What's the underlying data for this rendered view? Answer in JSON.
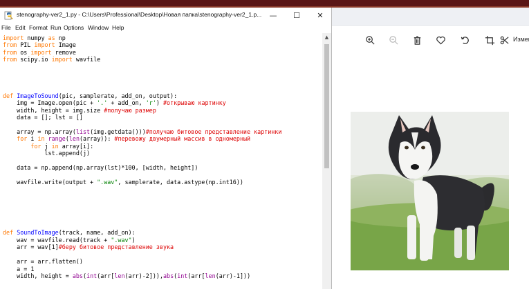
{
  "editor_window": {
    "title": "stenography-ver2_1.py - C:\\Users\\Professional\\Desktop\\Новая папка\\stenography-ver2_1.p...",
    "controls": {
      "minimize": "—",
      "maximize": "☐",
      "close": "✕"
    },
    "menu": [
      "File",
      "Edit",
      "Format",
      "Run",
      "Options",
      "Window",
      "Help"
    ],
    "code_lines": [
      [
        {
          "t": "import",
          "c": "kw"
        },
        {
          "t": " numpy "
        },
        {
          "t": "as",
          "c": "kw"
        },
        {
          "t": " np"
        }
      ],
      [
        {
          "t": "from",
          "c": "kw"
        },
        {
          "t": " PIL "
        },
        {
          "t": "import",
          "c": "kw"
        },
        {
          "t": " Image"
        }
      ],
      [
        {
          "t": "from",
          "c": "kw"
        },
        {
          "t": " os "
        },
        {
          "t": "import",
          "c": "kw"
        },
        {
          "t": " remove"
        }
      ],
      [
        {
          "t": "from",
          "c": "kw"
        },
        {
          "t": " scipy.io "
        },
        {
          "t": "import",
          "c": "kw"
        },
        {
          "t": " wavfile"
        }
      ],
      [],
      [],
      [],
      [],
      [
        {
          "t": "def",
          "c": "kw"
        },
        {
          "t": " "
        },
        {
          "t": "ImageToSound",
          "c": "fn"
        },
        {
          "t": "(pic, samplerate, add_on, output):"
        }
      ],
      [
        {
          "t": "    img = Image.open(pic + "
        },
        {
          "t": "'.'",
          "c": "st"
        },
        {
          "t": " + add_on, "
        },
        {
          "t": "'r'",
          "c": "st"
        },
        {
          "t": ") "
        },
        {
          "t": "#открываю картинку",
          "c": "cm"
        }
      ],
      [
        {
          "t": "    width, height = img.size "
        },
        {
          "t": "#получаю размер",
          "c": "cm"
        }
      ],
      [
        {
          "t": "    data = []; lst = []"
        }
      ],
      [],
      [
        {
          "t": "    array = np.array("
        },
        {
          "t": "list",
          "c": "bi"
        },
        {
          "t": "(img.getdata()))"
        },
        {
          "t": "#получаю битовое представление картинки",
          "c": "cm"
        }
      ],
      [
        {
          "t": "    "
        },
        {
          "t": "for",
          "c": "kw"
        },
        {
          "t": " i "
        },
        {
          "t": "in",
          "c": "kw"
        },
        {
          "t": " "
        },
        {
          "t": "range",
          "c": "bi"
        },
        {
          "t": "("
        },
        {
          "t": "len",
          "c": "bi"
        },
        {
          "t": "(array)): "
        },
        {
          "t": "#перевожу двумерный массив в одномерный",
          "c": "cm"
        }
      ],
      [
        {
          "t": "        "
        },
        {
          "t": "for",
          "c": "kw"
        },
        {
          "t": " j "
        },
        {
          "t": "in",
          "c": "kw"
        },
        {
          "t": " array[i]:"
        }
      ],
      [
        {
          "t": "            lst.append(j)"
        }
      ],
      [],
      [
        {
          "t": "    data = np.append(np.array(lst)*100, [width, height])"
        }
      ],
      [],
      [
        {
          "t": "    wavfile.write(output + "
        },
        {
          "t": "\".wav\"",
          "c": "st"
        },
        {
          "t": ", samplerate, data.astype(np.int16))"
        }
      ],
      [],
      [],
      [],
      [],
      [],
      [],
      [
        {
          "t": "def",
          "c": "kw"
        },
        {
          "t": " "
        },
        {
          "t": "SoundToImage",
          "c": "fn"
        },
        {
          "t": "(track, name, add_on):"
        }
      ],
      [
        {
          "t": "    wav = wavfile.read(track + "
        },
        {
          "t": "\".wav\"",
          "c": "st"
        },
        {
          "t": ")"
        }
      ],
      [
        {
          "t": "    arr = wav[1]"
        },
        {
          "t": "#беру битовое представление звука",
          "c": "cm"
        }
      ],
      [],
      [
        {
          "t": "    arr = arr.flatten()"
        }
      ],
      [
        {
          "t": "    a = 1"
        }
      ],
      [
        {
          "t": "    width, height = "
        },
        {
          "t": "abs",
          "c": "bi"
        },
        {
          "t": "("
        },
        {
          "t": "int",
          "c": "bi"
        },
        {
          "t": "(arr["
        },
        {
          "t": "len",
          "c": "bi"
        },
        {
          "t": "(arr)-2])),"
        },
        {
          "t": "abs",
          "c": "bi"
        },
        {
          "t": "("
        },
        {
          "t": "int",
          "c": "bi"
        },
        {
          "t": "(arr["
        },
        {
          "t": "len",
          "c": "bi"
        },
        {
          "t": "(arr)-1]))"
        }
      ]
    ]
  },
  "syntax_colors": {
    "keyword": "#ff7700",
    "builtin": "#900090",
    "definition": "#0000ff",
    "string": "#008000",
    "comment": "#dd0000"
  },
  "photo_viewer": {
    "toolbar": [
      {
        "icon": "zoom-in-icon",
        "enabled": true
      },
      {
        "icon": "zoom-out-icon",
        "enabled": false
      },
      {
        "icon": "trash-icon",
        "enabled": true
      },
      {
        "icon": "heart-icon",
        "enabled": true
      },
      {
        "icon": "rotate-icon",
        "enabled": true
      },
      {
        "icon": "crop-icon",
        "enabled": true
      },
      {
        "icon": "edit-icon",
        "enabled": true
      }
    ],
    "edit_label": "Измен",
    "photo": "husky-dog"
  }
}
